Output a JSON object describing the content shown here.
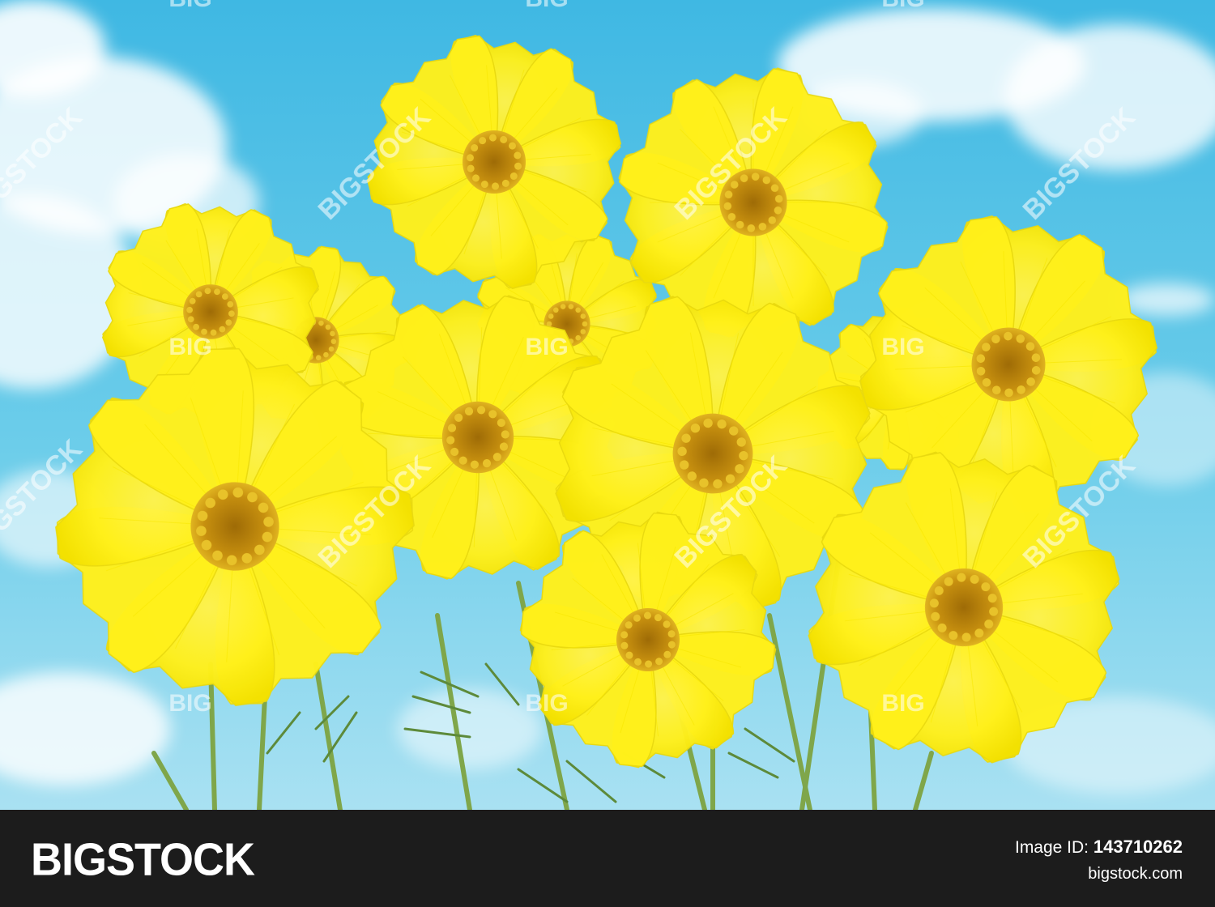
{
  "footer": {
    "brand": "BIGSTOCK",
    "id_label": "Image ID:",
    "id_value": "143710262",
    "site": "bigstock.com"
  },
  "watermarks": {
    "diagonal": "BIGSTOCK",
    "small": "BIG"
  },
  "colors": {
    "sky": "#6ccdea",
    "sky_light": "#a9e1f2",
    "petal": "#fff01a",
    "petal_shadow": "#e9d90f",
    "center": "#c7900f",
    "stem": "#7fa64a",
    "footer_bg": "#1c1c1c"
  }
}
